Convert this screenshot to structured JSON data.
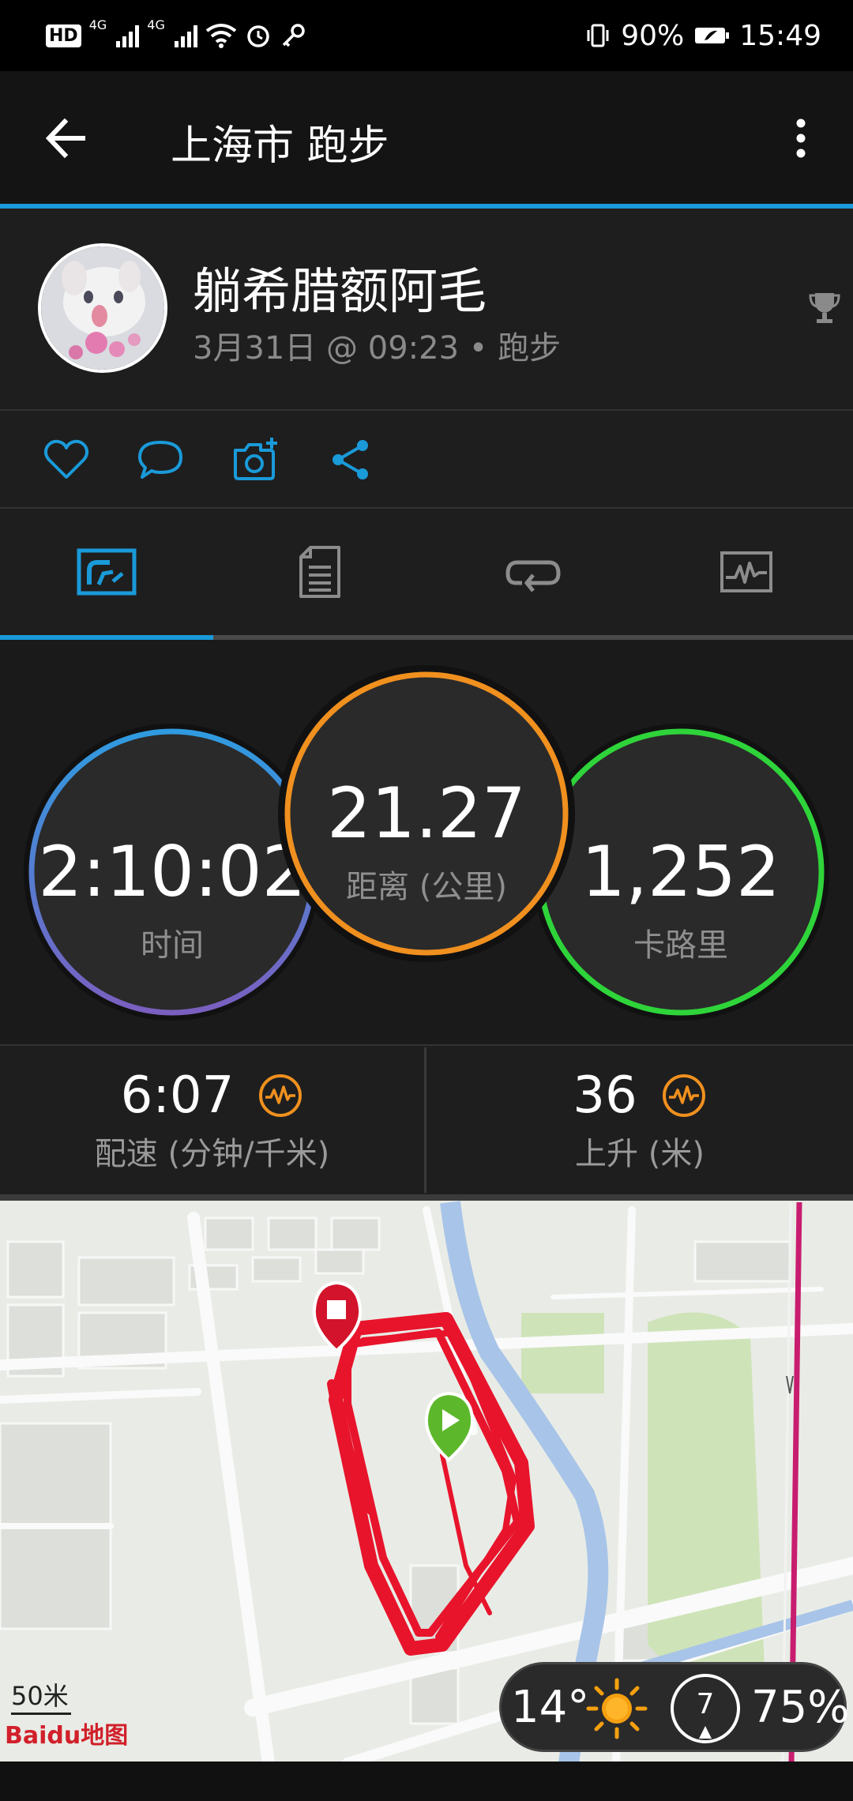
{
  "status_bar": {
    "hd": "HD",
    "net1": "4G",
    "net2": "4G",
    "battery": "90%",
    "time": "15:49"
  },
  "app_bar": {
    "title": "上海市 跑步",
    "back_icon": "arrow-left-icon",
    "menu_icon": "more-vert-icon"
  },
  "profile": {
    "name": "躺希腊额阿毛",
    "subtitle": "3月31日 @ 09:23 • 跑步",
    "trophy_icon": "trophy-icon"
  },
  "actions": [
    "like-icon",
    "comment-icon",
    "add-photo-icon",
    "share-icon"
  ],
  "tabs": [
    {
      "name": "overview",
      "icon": "stats-icon",
      "active": true
    },
    {
      "name": "details",
      "icon": "document-icon",
      "active": false
    },
    {
      "name": "laps",
      "icon": "loop-icon",
      "active": false
    },
    {
      "name": "charts",
      "icon": "chart-icon",
      "active": false
    }
  ],
  "stats": {
    "time": {
      "value": "2:10:02",
      "label": "时间"
    },
    "distance": {
      "value": "21.27",
      "label": "距离 (公里)"
    },
    "calories": {
      "value": "1,252",
      "label": "卡路里"
    }
  },
  "metrics": {
    "pace": {
      "value": "6:07",
      "label": "配速 (分钟/千米)"
    },
    "ascent": {
      "value": "36",
      "label": "上升 (米)"
    }
  },
  "map": {
    "scale": "50米",
    "provider": "Baidu地图",
    "weather": {
      "temp": "14°",
      "wind": "7",
      "humidity": "75%"
    }
  },
  "colors": {
    "accent": "#1a9ad9",
    "time_ring_start": "#2f9be0",
    "time_ring_end": "#7a5fc0",
    "distance_ring": "#f0901f",
    "calories_ring": "#2ed43a",
    "route": "#e8142c",
    "start_marker": "#5cb82a",
    "end_marker": "#d3132b"
  }
}
